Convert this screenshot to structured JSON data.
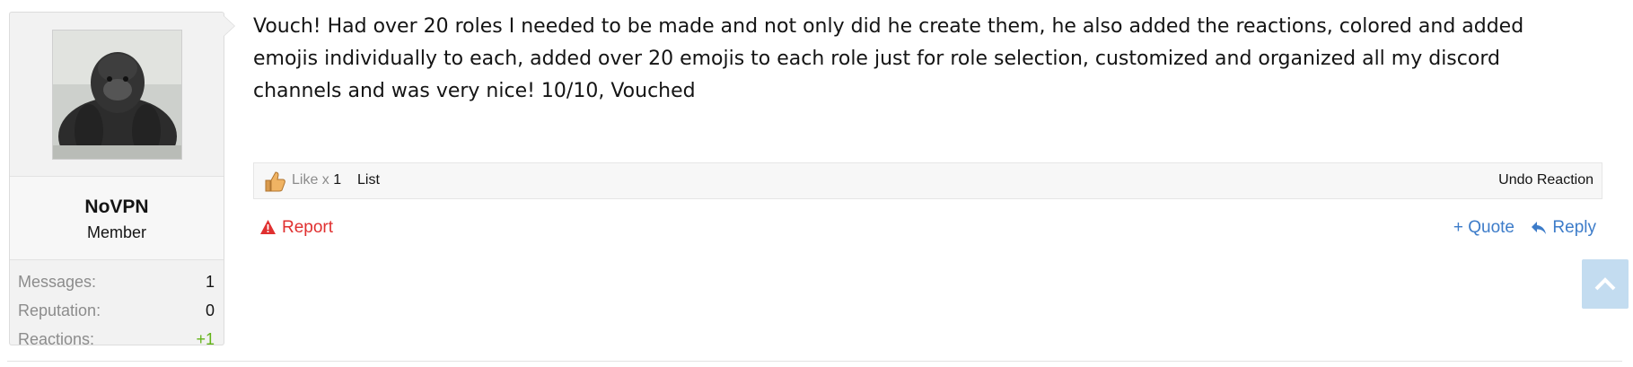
{
  "colors": {
    "report": "#e03030",
    "action_link": "#3d7cc9",
    "positive_reactions": "#63b317"
  },
  "user": {
    "name": "NoVPN",
    "title": "Member",
    "avatar_icon": "gorilla-avatar-photo",
    "stats": [
      {
        "label": "Messages:",
        "value": "1"
      },
      {
        "label": "Reputation:",
        "value": "0"
      },
      {
        "label": "Reactions:",
        "value": "+1"
      }
    ]
  },
  "post": {
    "body": "Vouch! Had over 20 roles I needed to be made and not only did he create them, he also added the reactions, colored and added emojis individually to each, added over 20 emojis to each role just for role selection, customized and organized all my discord channels and was very nice! 10/10, Vouched"
  },
  "reactions": {
    "icon": "thumbs-up-icon",
    "like_label": "Like x ",
    "like_count": "1",
    "list_label": "List",
    "undo_label": "Undo Reaction"
  },
  "actions": {
    "report_label": "Report",
    "report_icon": "warning-triangle-icon",
    "quote_label": "+ Quote",
    "reply_label": "Reply",
    "reply_icon": "reply-arrow-icon"
  },
  "scroll_top": {
    "icon": "chevron-up-icon"
  }
}
